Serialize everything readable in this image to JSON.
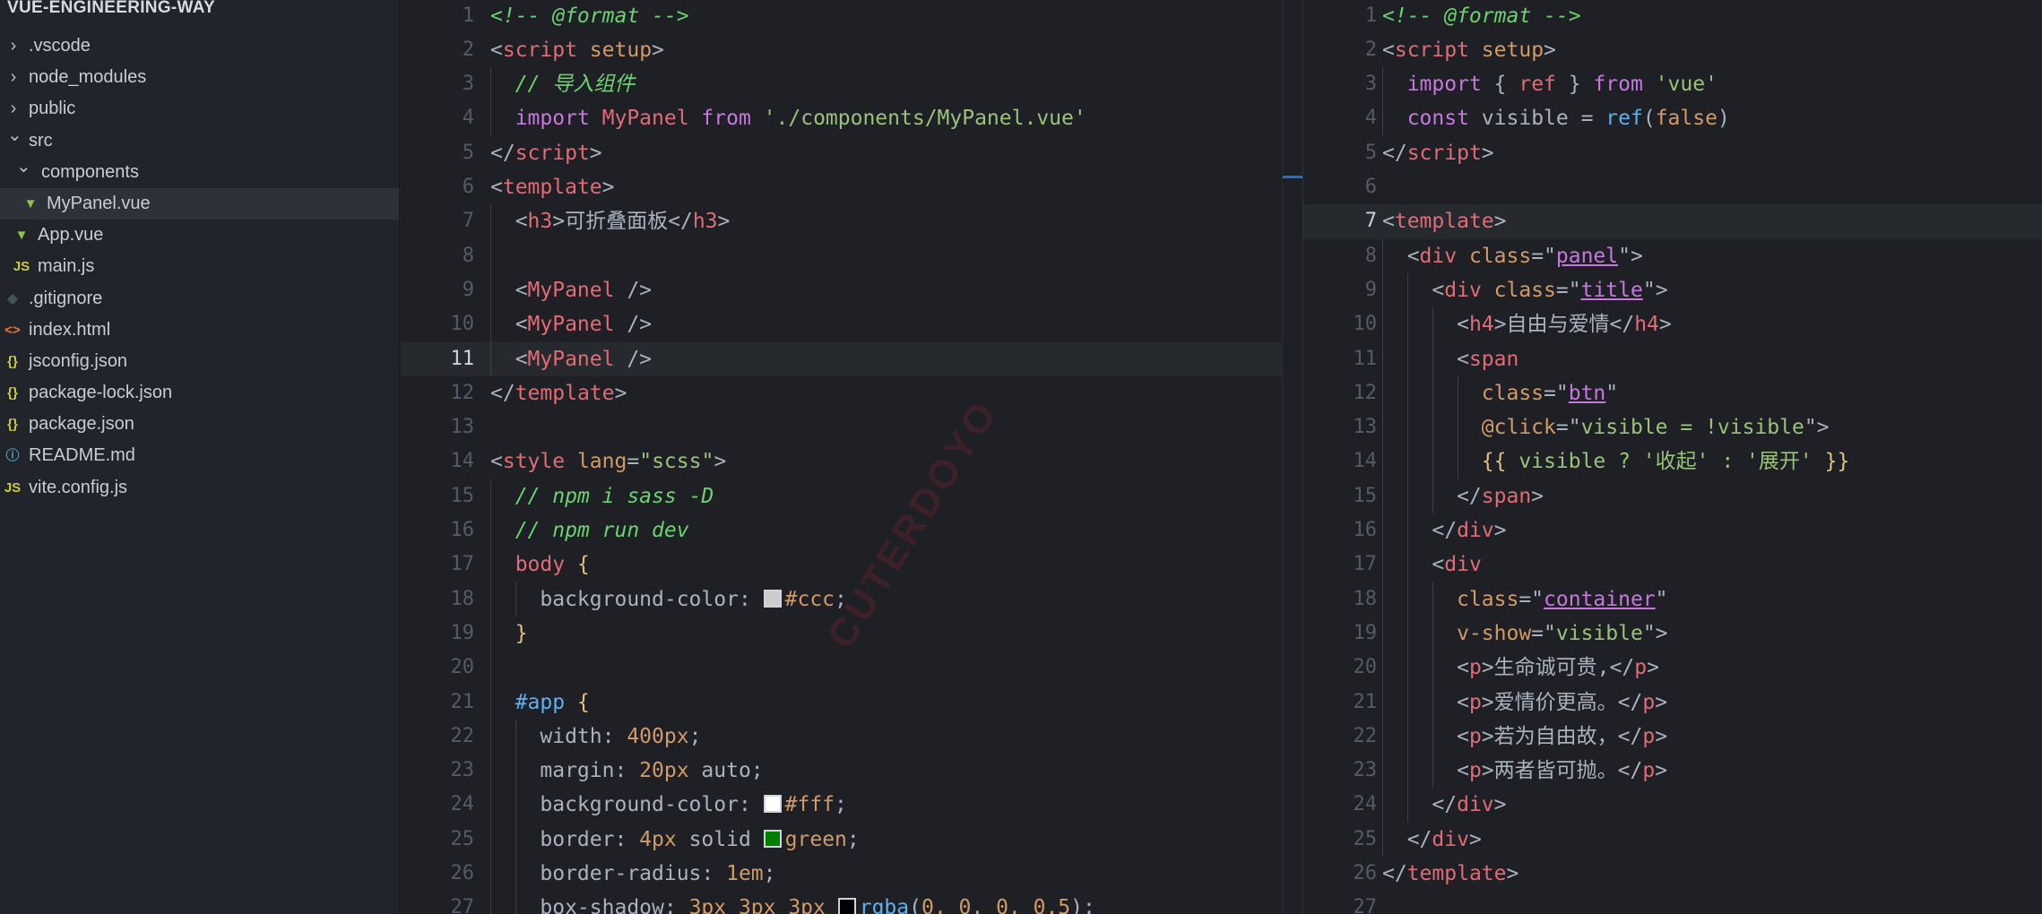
{
  "sidebar": {
    "project_title": "VUE-ENGINEERING-WAY",
    "items": [
      {
        "label": ".vscode",
        "type": "folder",
        "depth": 0,
        "icon": "chevron-right-icon"
      },
      {
        "label": "node_modules",
        "type": "folder",
        "depth": 0,
        "icon": "chevron-right-icon"
      },
      {
        "label": "public",
        "type": "folder",
        "depth": 0,
        "icon": "chevron-right-icon"
      },
      {
        "label": "src",
        "type": "folder-open",
        "depth": 0,
        "icon": "chevron-down-icon"
      },
      {
        "label": "components",
        "type": "folder-open",
        "depth": 1,
        "icon": "chevron-down-icon"
      },
      {
        "label": "MyPanel.vue",
        "type": "vue",
        "depth": 2,
        "icon": "vue-icon",
        "selected": true
      },
      {
        "label": "App.vue",
        "type": "vue",
        "depth": 1,
        "icon": "vue-icon"
      },
      {
        "label": "main.js",
        "type": "js",
        "depth": 1,
        "icon": "js-icon"
      },
      {
        "label": ".gitignore",
        "type": "git",
        "depth": 0,
        "icon": "git-icon"
      },
      {
        "label": "index.html",
        "type": "html",
        "depth": 0,
        "icon": "html-icon"
      },
      {
        "label": "jsconfig.json",
        "type": "json",
        "depth": 0,
        "icon": "json-icon"
      },
      {
        "label": "package-lock.json",
        "type": "json",
        "depth": 0,
        "icon": "json-icon"
      },
      {
        "label": "package.json",
        "type": "json",
        "depth": 0,
        "icon": "json-icon"
      },
      {
        "label": "README.md",
        "type": "info",
        "depth": 0,
        "icon": "info-icon"
      },
      {
        "label": "vite.config.js",
        "type": "js",
        "depth": 0,
        "icon": "js-icon"
      }
    ]
  },
  "icon_glyphs": {
    "vue-icon": "▼",
    "js-icon": "JS",
    "git-icon": "◆",
    "html-icon": "<>",
    "json-icon": "{}",
    "info-icon": "ⓘ"
  },
  "icon_colors": {
    "vue-icon": "#8dc149",
    "js-icon": "#cbcb41",
    "git-icon": "#41535b",
    "html-icon": "#e37933",
    "json-icon": "#cbcb41",
    "info-icon": "#519aba"
  },
  "editor_left": {
    "active_line": 11,
    "lines": [
      {
        "n": 1,
        "t": [
          [
            "cm",
            "<!-- @format -->"
          ]
        ]
      },
      {
        "n": 2,
        "t": [
          [
            "pn",
            "<"
          ],
          [
            "tg",
            "script"
          ],
          [
            "at",
            " setup"
          ],
          [
            "pn",
            ">"
          ]
        ]
      },
      {
        "n": 3,
        "t": [
          [
            "pn",
            "  "
          ],
          [
            "cm",
            "// 导入组件"
          ]
        ]
      },
      {
        "n": 4,
        "t": [
          [
            "pn",
            "  "
          ],
          [
            "kw",
            "import"
          ],
          [
            "id",
            " MyPanel"
          ],
          [
            "kw",
            " from"
          ],
          [
            "st",
            " './components/MyPanel.vue'"
          ]
        ]
      },
      {
        "n": 5,
        "t": [
          [
            "pn",
            "</"
          ],
          [
            "tg",
            "script"
          ],
          [
            "pn",
            ">"
          ]
        ]
      },
      {
        "n": 6,
        "t": [
          [
            "pn",
            "<"
          ],
          [
            "tg",
            "template"
          ],
          [
            "pn",
            ">"
          ]
        ]
      },
      {
        "n": 7,
        "t": [
          [
            "pn",
            "  <"
          ],
          [
            "tg",
            "h3"
          ],
          [
            "pn",
            ">"
          ],
          [
            "tx",
            "可折叠面板"
          ],
          [
            "pn",
            "</"
          ],
          [
            "tg",
            "h3"
          ],
          [
            "pn",
            ">"
          ]
        ]
      },
      {
        "n": 8,
        "t": []
      },
      {
        "n": 9,
        "t": [
          [
            "pn",
            "  <"
          ],
          [
            "tg",
            "MyPanel"
          ],
          [
            "pn",
            " />"
          ]
        ]
      },
      {
        "n": 10,
        "t": [
          [
            "pn",
            "  <"
          ],
          [
            "tg",
            "MyPanel"
          ],
          [
            "pn",
            " />"
          ]
        ]
      },
      {
        "n": 11,
        "t": [
          [
            "pn",
            "  <"
          ],
          [
            "tg",
            "MyPanel"
          ],
          [
            "pn",
            " />"
          ]
        ]
      },
      {
        "n": 12,
        "t": [
          [
            "pn",
            "</"
          ],
          [
            "tg",
            "template"
          ],
          [
            "pn",
            ">"
          ]
        ]
      },
      {
        "n": 13,
        "t": []
      },
      {
        "n": 14,
        "t": [
          [
            "pn",
            "<"
          ],
          [
            "tg",
            "style"
          ],
          [
            "at",
            " lang"
          ],
          [
            "pn",
            "="
          ],
          [
            "st",
            "\"scss\""
          ],
          [
            "pn",
            ">"
          ]
        ]
      },
      {
        "n": 15,
        "t": [
          [
            "pn",
            "  "
          ],
          [
            "cm",
            "// npm i sass -D"
          ]
        ]
      },
      {
        "n": 16,
        "t": [
          [
            "pn",
            "  "
          ],
          [
            "cm",
            "// npm run dev"
          ]
        ]
      },
      {
        "n": 17,
        "t": [
          [
            "pn",
            "  "
          ],
          [
            "tg",
            "body"
          ],
          [
            "br",
            " {"
          ]
        ]
      },
      {
        "n": 18,
        "t": [
          [
            "pn",
            "    background-color: "
          ],
          [
            "sw",
            "#cccccc"
          ],
          [
            "nm",
            "#ccc"
          ],
          [
            "pn",
            ";"
          ]
        ]
      },
      {
        "n": 19,
        "t": [
          [
            "pn",
            "  "
          ],
          [
            "br",
            "}"
          ]
        ]
      },
      {
        "n": 20,
        "t": []
      },
      {
        "n": 21,
        "t": [
          [
            "pn",
            "  "
          ],
          [
            "fn",
            "#app"
          ],
          [
            "br",
            " {"
          ]
        ]
      },
      {
        "n": 22,
        "t": [
          [
            "pn",
            "    width: "
          ],
          [
            "nm",
            "400px"
          ],
          [
            "pn",
            ";"
          ]
        ]
      },
      {
        "n": 23,
        "t": [
          [
            "pn",
            "    margin: "
          ],
          [
            "nm",
            "20px"
          ],
          [
            "pn",
            " auto;"
          ]
        ]
      },
      {
        "n": 24,
        "t": [
          [
            "pn",
            "    background-color: "
          ],
          [
            "sw",
            "#ffffff"
          ],
          [
            "nm",
            "#fff"
          ],
          [
            "pn",
            ";"
          ]
        ]
      },
      {
        "n": 25,
        "t": [
          [
            "pn",
            "    border: "
          ],
          [
            "nm",
            "4px"
          ],
          [
            "pn",
            " solid "
          ],
          [
            "sw",
            "#008000"
          ],
          [
            "nm",
            "green"
          ],
          [
            "pn",
            ";"
          ]
        ]
      },
      {
        "n": 26,
        "t": [
          [
            "pn",
            "    border-radius: "
          ],
          [
            "nm",
            "1em"
          ],
          [
            "pn",
            ";"
          ]
        ]
      },
      {
        "n": 27,
        "t": [
          [
            "pn",
            "    box-shadow: "
          ],
          [
            "nm",
            "3px 3px 3px "
          ],
          [
            "sw",
            "#000000"
          ],
          [
            "fn",
            "rgba"
          ],
          [
            "pn",
            "("
          ],
          [
            "nm",
            "0, 0, 0, 0.5"
          ],
          [
            "pn",
            ");"
          ]
        ]
      }
    ]
  },
  "editor_right": {
    "active_line": 7,
    "lines": [
      {
        "n": 1,
        "t": [
          [
            "cm",
            "<!-- @format -->"
          ]
        ]
      },
      {
        "n": 2,
        "t": [
          [
            "pn",
            "<"
          ],
          [
            "tg",
            "script"
          ],
          [
            "at",
            " setup"
          ],
          [
            "pn",
            ">"
          ]
        ]
      },
      {
        "n": 3,
        "t": [
          [
            "pn",
            "  "
          ],
          [
            "kw",
            "import"
          ],
          [
            "pn",
            " { "
          ],
          [
            "id",
            "ref"
          ],
          [
            "pn",
            " } "
          ],
          [
            "kw",
            "from"
          ],
          [
            "st",
            " 'vue'"
          ]
        ]
      },
      {
        "n": 4,
        "t": [
          [
            "pn",
            "  "
          ],
          [
            "kw",
            "const"
          ],
          [
            "pr",
            " visible"
          ],
          [
            "pn",
            " = "
          ],
          [
            "fn",
            "ref"
          ],
          [
            "pn",
            "("
          ],
          [
            "nm",
            "false"
          ],
          [
            "pn",
            ")"
          ]
        ]
      },
      {
        "n": 5,
        "t": [
          [
            "pn",
            "</"
          ],
          [
            "tg",
            "script"
          ],
          [
            "pn",
            ">"
          ]
        ]
      },
      {
        "n": 6,
        "t": []
      },
      {
        "n": 7,
        "t": [
          [
            "pn",
            "<"
          ],
          [
            "tg",
            "template"
          ],
          [
            "pn",
            ">"
          ]
        ]
      },
      {
        "n": 8,
        "t": [
          [
            "pn",
            "  <"
          ],
          [
            "tg",
            "div"
          ],
          [
            "at",
            " class"
          ],
          [
            "pn",
            "=\""
          ],
          [
            "hl",
            "panel"
          ],
          [
            "pn",
            "\">"
          ]
        ]
      },
      {
        "n": 9,
        "t": [
          [
            "pn",
            "    <"
          ],
          [
            "tg",
            "div"
          ],
          [
            "at",
            " class"
          ],
          [
            "pn",
            "=\""
          ],
          [
            "hl",
            "title"
          ],
          [
            "pn",
            "\">"
          ]
        ]
      },
      {
        "n": 10,
        "t": [
          [
            "pn",
            "      <"
          ],
          [
            "tg",
            "h4"
          ],
          [
            "pn",
            ">"
          ],
          [
            "tx",
            "自由与爱情"
          ],
          [
            "pn",
            "</"
          ],
          [
            "tg",
            "h4"
          ],
          [
            "pn",
            ">"
          ]
        ]
      },
      {
        "n": 11,
        "t": [
          [
            "pn",
            "      <"
          ],
          [
            "tg",
            "span"
          ]
        ]
      },
      {
        "n": 12,
        "t": [
          [
            "at",
            "        class"
          ],
          [
            "pn",
            "=\""
          ],
          [
            "hl",
            "btn"
          ],
          [
            "pn",
            "\""
          ]
        ]
      },
      {
        "n": 13,
        "t": [
          [
            "at",
            "        @click"
          ],
          [
            "pn",
            "=\""
          ],
          [
            "st",
            "visible = !visible"
          ],
          [
            "pn",
            "\">"
          ]
        ]
      },
      {
        "n": 14,
        "t": [
          [
            "br",
            "        {{"
          ],
          [
            "st",
            " visible ? '收起' : '展开' "
          ],
          [
            "br",
            "}}"
          ]
        ]
      },
      {
        "n": 15,
        "t": [
          [
            "pn",
            "      </"
          ],
          [
            "tg",
            "span"
          ],
          [
            "pn",
            ">"
          ]
        ]
      },
      {
        "n": 16,
        "t": [
          [
            "pn",
            "    </"
          ],
          [
            "tg",
            "div"
          ],
          [
            "pn",
            ">"
          ]
        ]
      },
      {
        "n": 17,
        "t": [
          [
            "pn",
            "    <"
          ],
          [
            "tg",
            "div"
          ]
        ]
      },
      {
        "n": 18,
        "t": [
          [
            "at",
            "      class"
          ],
          [
            "pn",
            "=\""
          ],
          [
            "hl",
            "container"
          ],
          [
            "pn",
            "\""
          ]
        ]
      },
      {
        "n": 19,
        "t": [
          [
            "at",
            "      v-show"
          ],
          [
            "pn",
            "=\""
          ],
          [
            "st",
            "visible"
          ],
          [
            "pn",
            "\">"
          ]
        ]
      },
      {
        "n": 20,
        "t": [
          [
            "pn",
            "      <"
          ],
          [
            "tg",
            "p"
          ],
          [
            "pn",
            ">"
          ],
          [
            "tx",
            "生命诚可贵,"
          ],
          [
            "pn",
            "</"
          ],
          [
            "tg",
            "p"
          ],
          [
            "pn",
            ">"
          ]
        ]
      },
      {
        "n": 21,
        "t": [
          [
            "pn",
            "      <"
          ],
          [
            "tg",
            "p"
          ],
          [
            "pn",
            ">"
          ],
          [
            "tx",
            "爱情价更高。"
          ],
          [
            "pn",
            "</"
          ],
          [
            "tg",
            "p"
          ],
          [
            "pn",
            ">"
          ]
        ]
      },
      {
        "n": 22,
        "t": [
          [
            "pn",
            "      <"
          ],
          [
            "tg",
            "p"
          ],
          [
            "pn",
            ">"
          ],
          [
            "tx",
            "若为自由故，"
          ],
          [
            "pn",
            "</"
          ],
          [
            "tg",
            "p"
          ],
          [
            "pn",
            ">"
          ]
        ]
      },
      {
        "n": 23,
        "t": [
          [
            "pn",
            "      <"
          ],
          [
            "tg",
            "p"
          ],
          [
            "pn",
            ">"
          ],
          [
            "tx",
            "两者皆可抛。"
          ],
          [
            "pn",
            "</"
          ],
          [
            "tg",
            "p"
          ],
          [
            "pn",
            ">"
          ]
        ]
      },
      {
        "n": 24,
        "t": [
          [
            "pn",
            "    </"
          ],
          [
            "tg",
            "div"
          ],
          [
            "pn",
            ">"
          ]
        ]
      },
      {
        "n": 25,
        "t": [
          [
            "pn",
            "  </"
          ],
          [
            "tg",
            "div"
          ],
          [
            "pn",
            ">"
          ]
        ]
      },
      {
        "n": 26,
        "t": [
          [
            "pn",
            "</"
          ],
          [
            "tg",
            "template"
          ],
          [
            "pn",
            ">"
          ]
        ]
      },
      {
        "n": 27,
        "t": []
      }
    ]
  },
  "watermark": "CUTERDOYO"
}
